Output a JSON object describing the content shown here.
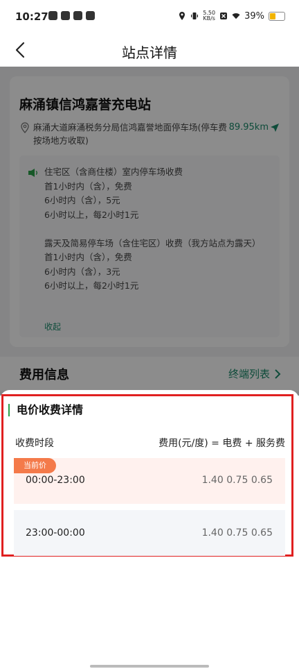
{
  "status_bar": {
    "time": "10:27",
    "speed_value": "5.50",
    "speed_unit": "KB/s",
    "battery": "39%"
  },
  "nav": {
    "title": "站点详情"
  },
  "station": {
    "name": "麻涌镇信鸿嘉誉充电站",
    "address": "麻涌大道麻涌税务分局信鸿嘉誉地面停车场(停车费按场地方收取)",
    "distance": "89.95km"
  },
  "notice": {
    "text": "住宅区（含商住楼）室内停车场收费\n首1小时内（含），免费\n6小时内（含），5元\n6小时以上，每2小时1元\n\n露天及简易停车场（含住宅区）收费（我方站点为露天）\n首1小时内（含），免费\n6小时内（含），3元\n6小时以上，每2小时1元",
    "collapse": "收起"
  },
  "fee_section": {
    "title": "费用信息",
    "link": "终端列表"
  },
  "price_sheet": {
    "title": "电价收费详情",
    "col_left": "收费时段",
    "col_right": "费用(元/度) = 电费 + 服务费",
    "current_badge": "当前价",
    "rows": [
      {
        "time": "00:00-23:00",
        "prices": "1.40 0.75 0.65"
      },
      {
        "time": "23:00-00:00",
        "prices": "1.40 0.75 0.65"
      }
    ]
  },
  "colors": {
    "accent": "#1b8a6b",
    "highlight_border": "#e02020",
    "badge": "#f47a4a",
    "title_bar": "#2aa04a"
  }
}
